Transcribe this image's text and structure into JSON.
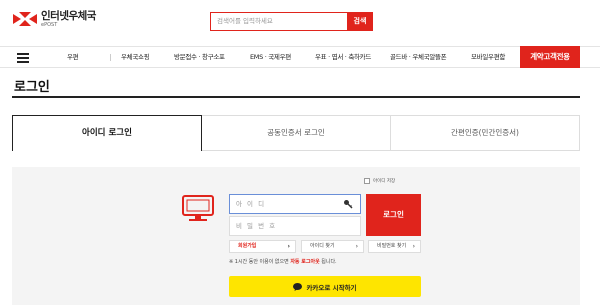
{
  "header": {
    "logo_title": "인터넷우체국",
    "logo_sub": "ePOST",
    "search_placeholder": "검색어를 입력하세요",
    "search_button": "검색"
  },
  "nav": {
    "items": [
      "우편",
      "우체국쇼핑",
      "방문접수 · 창구소포",
      "EMS · 국제우편",
      "우표 · 엽서 · 축하카드",
      "골드바 · 우체국알뜰폰",
      "모바일우편함"
    ],
    "cta": "계약고객전용"
  },
  "page": {
    "title": "로그인"
  },
  "tabs": [
    "아이디 로그인",
    "공동인증서 로그인",
    "간편인증(민간인증서)"
  ],
  "login": {
    "keep_login": "아이디 저장",
    "id_placeholder": "아 이 디",
    "pw_placeholder": "비 밀 번 호",
    "login_button": "로그인",
    "signup": "회원가입",
    "find_id": "아이디 찾기",
    "find_pw": "비밀번호 찾기",
    "notice_prefix": "※ 1시간 동안 이용이 없으면 ",
    "notice_highlight": "자동 로그아웃",
    "notice_suffix": " 됩니다.",
    "kakao_button": "카카오로 시작하기"
  },
  "colors": {
    "brand_red": "#e0241c",
    "kakao_yellow": "#fee500",
    "login_bg": "#f4f4f4"
  }
}
